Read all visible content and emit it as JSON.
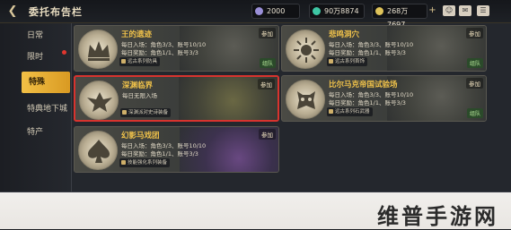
{
  "header": {
    "title": "委托布告栏",
    "resources": [
      {
        "value": "2000",
        "color": "#9a8fd8"
      },
      {
        "value": "90万8874",
        "color": "#3ec7a4"
      },
      {
        "value": "268万7697",
        "color": "#e0c45a"
      }
    ],
    "icons": [
      "add-friend-icon",
      "mail-icon",
      "menu-icon"
    ]
  },
  "sidebar": {
    "items": [
      {
        "label": "日常"
      },
      {
        "label": "限时"
      },
      {
        "label": "特殊"
      },
      {
        "label": "特典地下城"
      },
      {
        "label": "特产"
      }
    ]
  },
  "cards": [
    {
      "name": "王的遗迹",
      "line1": "每日入场：角色3/3、账号10/10",
      "line2": "每日奖励：角色1/1、账号3/3",
      "tag": "远古系列防具",
      "join": "参加",
      "team": "组队"
    },
    {
      "name": "悲鸣洞穴",
      "line1": "每日入场：角色3/3、账号10/10",
      "line2": "每日奖励：角色1/1、账号3/3",
      "tag": "远古系列首饰",
      "join": "参加",
      "team": "组队"
    },
    {
      "name": "深渊临界",
      "line1": "每日无限入场",
      "line2": "",
      "tag": "深渊派对史诗装备",
      "join": "参加",
      "team": ""
    },
    {
      "name": "比尔马克帝国试验场",
      "line1": "每日入场：角色3/3、账号10/10",
      "line2": "每日奖励：角色1/1、账号3/3",
      "tag": "远古系列石武器",
      "join": "参加",
      "team": "组队"
    },
    {
      "name": "幻影马戏团",
      "line1": "每日入场：角色3/3、账号10/10",
      "line2": "每日奖励：角色1/1、账号3/3",
      "tag": "技能强化系列装备",
      "join": "参加",
      "team": ""
    }
  ],
  "watermark": "维普手游网"
}
